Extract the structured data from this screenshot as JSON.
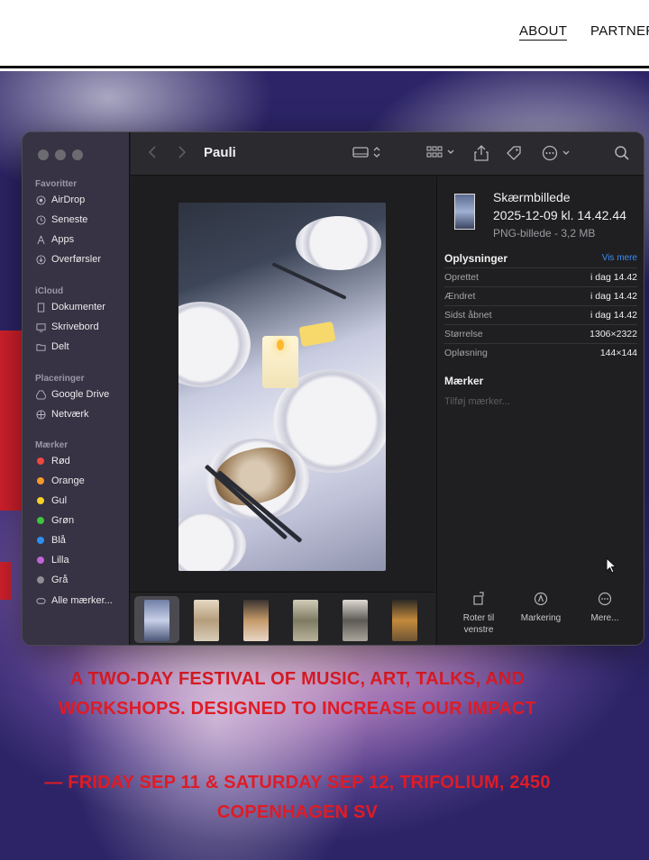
{
  "site": {
    "nav": {
      "about": "ABOUT",
      "partner": "PARTNER"
    },
    "festival_description": "A TWO-DAY FESTIVAL OF MUSIC, ART, TALKS, AND WORKSHOPS. DESIGNED TO INCREASE OUR IMPACT",
    "festival_date": "— FRIDAY SEP 11 & SATURDAY SEP 12, TRIFOLIUM, 2450 COPENHAGEN SV",
    "accent_color": "#e01b25"
  },
  "finder": {
    "title": "Pauli",
    "sidebar": {
      "favorites_header": "Favoritter",
      "favorites": [
        {
          "label": "AirDrop",
          "icon": "airdrop-icon"
        },
        {
          "label": "Seneste",
          "icon": "clock-icon"
        },
        {
          "label": "Apps",
          "icon": "apps-icon"
        },
        {
          "label": "Overførsler",
          "icon": "download-icon"
        }
      ],
      "icloud_header": "iCloud",
      "icloud": [
        {
          "label": "Dokumenter",
          "icon": "document-icon"
        },
        {
          "label": "Skrivebord",
          "icon": "desktop-icon"
        },
        {
          "label": "Delt",
          "icon": "shared-folder-icon"
        }
      ],
      "locations_header": "Placeringer",
      "locations": [
        {
          "label": "Google Drive",
          "icon": "drive-icon"
        },
        {
          "label": "Netværk",
          "icon": "network-icon"
        }
      ],
      "tags_header": "Mærker",
      "tags": [
        {
          "label": "Rød",
          "color": "#f0473f"
        },
        {
          "label": "Orange",
          "color": "#f39a2b"
        },
        {
          "label": "Gul",
          "color": "#f4d227"
        },
        {
          "label": "Grøn",
          "color": "#3ec43e"
        },
        {
          "label": "Blå",
          "color": "#2f8ff0"
        },
        {
          "label": "Lilla",
          "color": "#c065d6"
        },
        {
          "label": "Grå",
          "color": "#8e8e93"
        }
      ],
      "all_tags": "Alle mærker..."
    },
    "info": {
      "file_name_line1": "Skærmbillede",
      "file_name_line2": "2025-12-09 kl. 14.42.44",
      "file_type": "PNG-billede - 3,2 MB",
      "info_header": "Oplysninger",
      "show_more": "Vis mere",
      "rows": [
        {
          "key": "Oprettet",
          "value": "i dag 14.42"
        },
        {
          "key": "Ændret",
          "value": "i dag 14.42"
        },
        {
          "key": "Sidst åbnet",
          "value": "i dag 14.42"
        },
        {
          "key": "Størrelse",
          "value": "1306×2322"
        },
        {
          "key": "Opløsning",
          "value": "144×144"
        }
      ],
      "tags_header": "Mærker",
      "tags_placeholder": "Tilføj mærker..."
    },
    "actions": {
      "rotate_line1": "Roter til",
      "rotate_line2": "venstre",
      "markup": "Markering",
      "more": "Mere..."
    }
  }
}
